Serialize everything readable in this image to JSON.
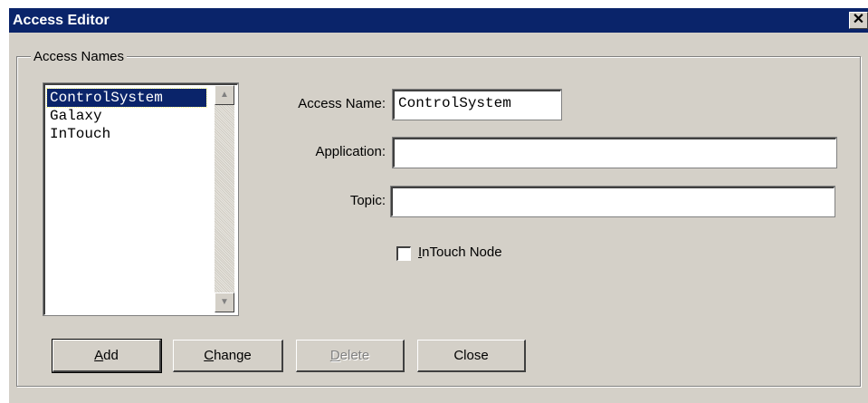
{
  "window": {
    "title": "Access Editor",
    "close_glyph": "✕"
  },
  "group": {
    "label": "Access Names"
  },
  "list": {
    "items": [
      {
        "label": "ControlSystem",
        "selected": true
      },
      {
        "label": "Galaxy",
        "selected": false
      },
      {
        "label": "InTouch",
        "selected": false
      }
    ],
    "scroll_up_glyph": "▲",
    "scroll_down_glyph": "▼"
  },
  "form": {
    "access_name_label": "Access Name:",
    "access_name_value": "ControlSystem",
    "application_label": "Application:",
    "application_value": "",
    "topic_label": "Topic:",
    "topic_value": "",
    "intouch_node_label": "InTouch Node",
    "intouch_node_checked": false
  },
  "buttons": {
    "add": "Add",
    "change": "Change",
    "delete": "Delete",
    "close": "Close"
  },
  "colors": {
    "titlebar": "#0a246a",
    "face": "#d4d0c8",
    "selection": "#0a246a"
  }
}
